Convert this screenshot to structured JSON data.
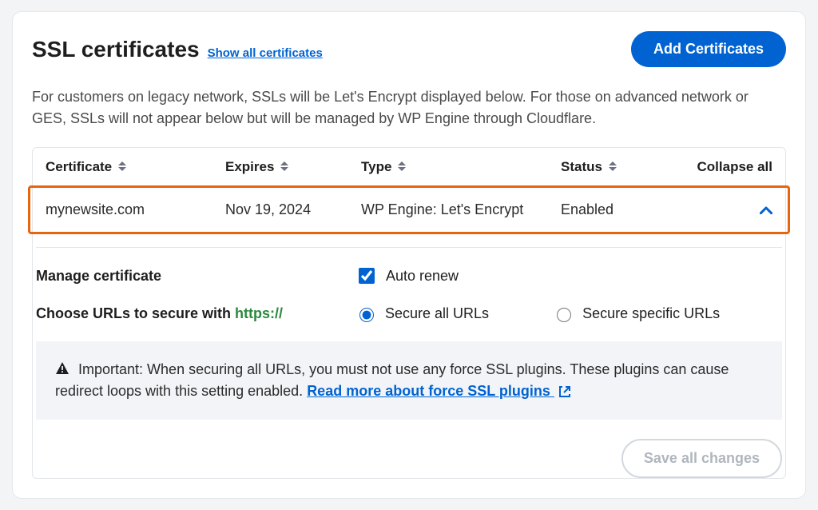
{
  "header": {
    "title": "SSL certificates",
    "show_all": "Show all certificates",
    "add_button": "Add Certificates"
  },
  "description": "For customers on legacy network, SSLs will be Let's Encrypt displayed below. For those on advanced network or GES, SSLs will not appear below but will be managed by WP Engine through Cloudflare.",
  "table": {
    "columns": {
      "certificate": "Certificate",
      "expires": "Expires",
      "type": "Type",
      "status": "Status",
      "collapse": "Collapse all"
    },
    "rows": [
      {
        "certificate": "mynewsite.com",
        "expires": "Nov 19, 2024",
        "type": "WP Engine: Let's Encrypt",
        "status": "Enabled"
      }
    ]
  },
  "manage": {
    "title": "Manage certificate",
    "auto_renew": "Auto renew",
    "choose_urls_prefix": "Choose URLs to secure with ",
    "choose_urls_https": "https://",
    "secure_all": "Secure all URLs",
    "secure_specific": "Secure specific URLs"
  },
  "info": {
    "prefix": "Important: When securing all URLs, you must not use any force SSL plugins. These plugins can cause redirect loops with this setting enabled. ",
    "link": "Read more about force SSL plugins "
  },
  "footer": {
    "save": "Save all changes"
  }
}
